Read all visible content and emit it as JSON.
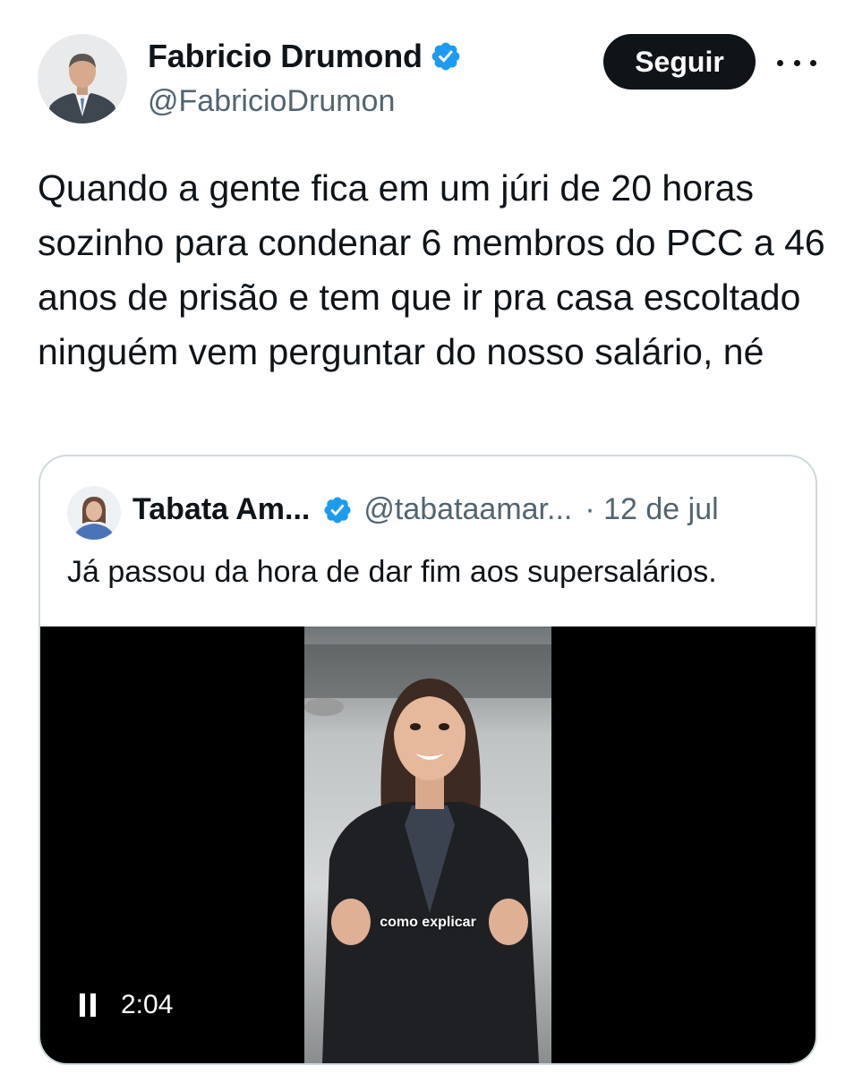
{
  "author": {
    "name": "Fabricio Drumond",
    "handle": "@FabricioDrumon",
    "verified": true
  },
  "actions": {
    "follow_label": "Seguir",
    "more_icon": "more-horizontal-icon"
  },
  "tweet": {
    "text": "Quando a gente fica em um júri de 20 horas sozinho para condenar 6 membros do PCC a 46 anos de prisão e tem que ir pra casa escoltado ninguém vem perguntar do nosso salário, né"
  },
  "quoted": {
    "name": "Tabata Am...",
    "handle": "@tabataamar...",
    "date": "· 12 de jul",
    "verified": true,
    "text": "Já passou da hora de dar fim aos supersalários.",
    "video": {
      "time": "2:04",
      "caption": "como explicar",
      "control_icon": "pause-icon"
    }
  },
  "colors": {
    "verified_blue": "#1d9bf0",
    "text_primary": "#0f1419",
    "text_secondary": "#536471",
    "border": "#cfd9de",
    "button_bg": "#0f1419"
  }
}
